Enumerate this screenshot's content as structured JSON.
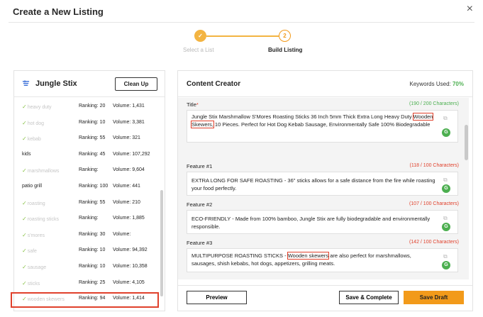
{
  "header": {
    "title": "Create a New Listing",
    "close": "×"
  },
  "stepper": {
    "steps": [
      {
        "icon": "check-icon",
        "number": "✓",
        "label": "Select a List"
      },
      {
        "number": "2",
        "label": "Build Listing"
      }
    ]
  },
  "keyword_panel": {
    "title": "Jungle Stix",
    "cleanup_label": "Clean Up",
    "check_mark": "✓",
    "rows": [
      {
        "keyword": "heavy duty",
        "done": true,
        "ranking": "Ranking: 20",
        "volume": "Volume: 1,431"
      },
      {
        "keyword": "hot dog",
        "done": true,
        "ranking": "Ranking: 10",
        "volume": "Volume: 3,381"
      },
      {
        "keyword": "kebab",
        "done": true,
        "ranking": "Ranking: 55",
        "volume": "Volume: 321"
      },
      {
        "keyword": "kids",
        "done": false,
        "ranking": "Ranking: 45",
        "volume": "Volume: 107,292"
      },
      {
        "keyword": "marshmallows",
        "done": true,
        "ranking": "Ranking:",
        "volume": "Volume: 9,604"
      },
      {
        "keyword": "patio grill",
        "done": false,
        "ranking": "Ranking: 100",
        "volume": "Volume: 441"
      },
      {
        "keyword": "roasting",
        "done": true,
        "ranking": "Ranking: 55",
        "volume": "Volume: 210"
      },
      {
        "keyword": "roasting sticks",
        "done": true,
        "ranking": "Ranking:",
        "volume": "Volume: 1,885"
      },
      {
        "keyword": "s'mores",
        "done": true,
        "ranking": "Ranking: 30",
        "volume": "Volume:"
      },
      {
        "keyword": "safe",
        "done": true,
        "ranking": "Ranking: 10",
        "volume": "Volume: 94,392"
      },
      {
        "keyword": "sausage",
        "done": true,
        "ranking": "Ranking: 10",
        "volume": "Volume: 10,358"
      },
      {
        "keyword": "sticks",
        "done": true,
        "ranking": "Ranking: 25",
        "volume": "Volume: 4,105"
      },
      {
        "keyword": "wooden skewers",
        "done": true,
        "ranking": "Ranking: 94",
        "volume": "Volume: 1,414"
      }
    ]
  },
  "content_creator": {
    "title": "Content Creator",
    "keywords_used_label": "Keywords Used:",
    "keywords_used_value": "70%",
    "fields": [
      {
        "label": "Title",
        "required": "*",
        "count": "(190 / 200 Characters)",
        "text_before": "Jungle Stix Marshmallow S'Mores Roasting Sticks 36 Inch 5mm Thick Extra Long Heavy Duty ",
        "highlight": "Wooden Skewers,",
        "text_after": " 10 Pieces. Perfect for Hot Dog Kebab Sausage, Environmentally Safe 100% Biodegradable"
      },
      {
        "label": "Feature #1",
        "count": "(118 / 100 Characters)",
        "text": "EXTRA LONG FOR SAFE ROASTING - 36\" sticks allows for a safe distance from the fire while roasting your food perfectly."
      },
      {
        "label": "Feature #2",
        "count": "(107 / 100 Characters)",
        "text": "ECO-FRIENDLY - Made from 100% bamboo, Jungle Stix are fully biodegradable and environmentally responsible."
      },
      {
        "label": "Feature #3",
        "count": "(142 / 100 Characters)",
        "text_before": "MULTIPURPOSE ROASTING STICKS - ",
        "highlight": "Wooden skewers",
        "text_after": " are also perfect for marshmallows, sausages, shish kebabs, hot dogs, appetizers, grilling meats."
      }
    ],
    "footer": {
      "preview": "Preview",
      "save_complete": "Save & Complete",
      "save_draft": "Save Draft"
    }
  },
  "colors": {
    "accent": "#f29a1a",
    "highlight": "#e0412c",
    "success": "#4caf50"
  }
}
